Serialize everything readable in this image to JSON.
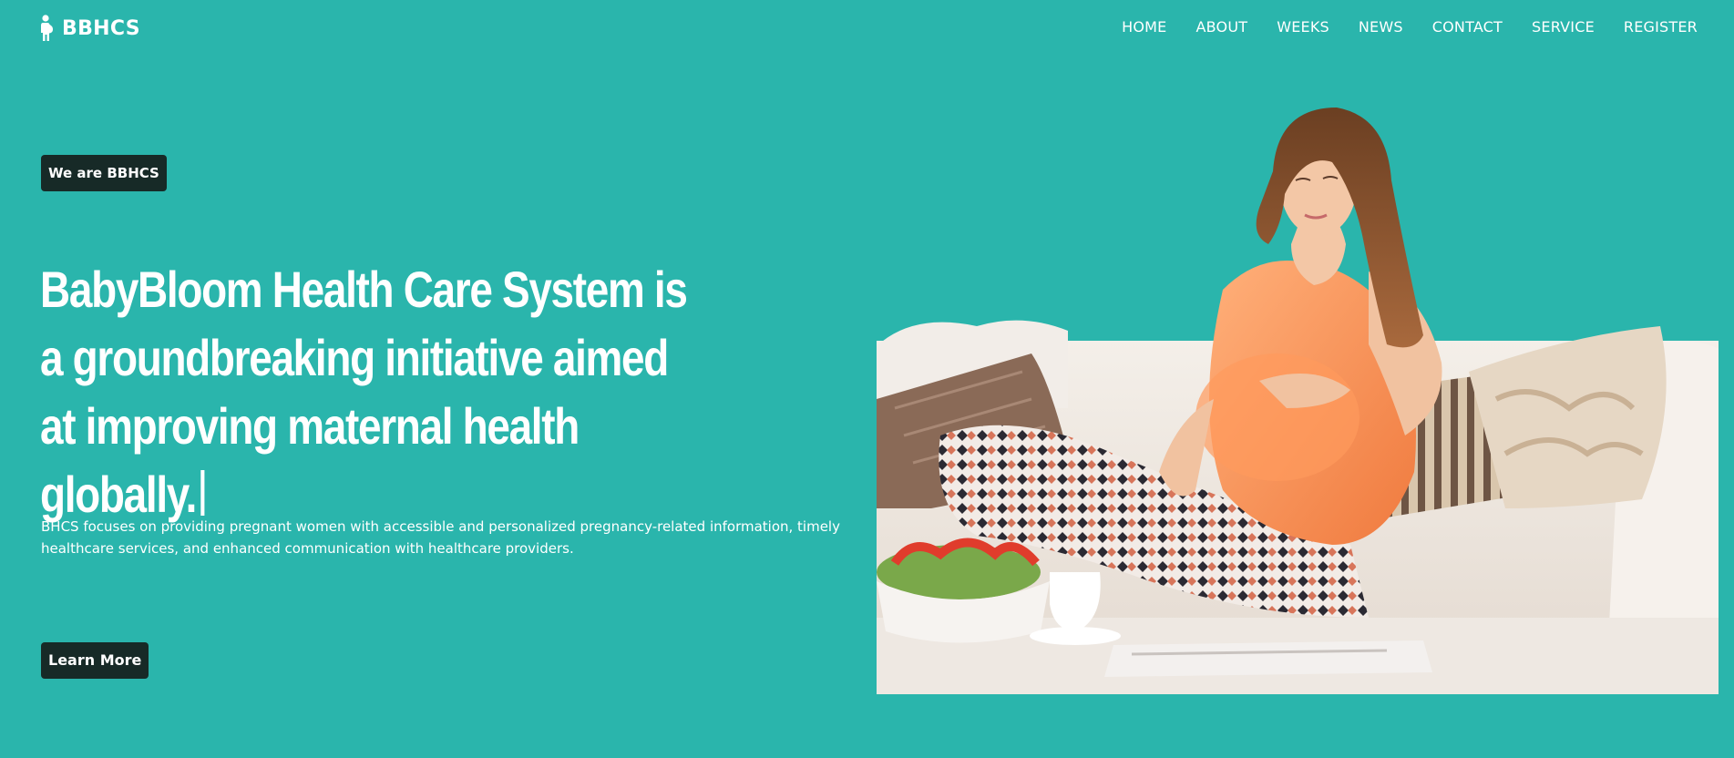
{
  "brand": {
    "name": "BBHCS",
    "icon": "pregnant-woman-icon"
  },
  "nav": {
    "items": [
      {
        "label": "HOME"
      },
      {
        "label": "ABOUT"
      },
      {
        "label": "WEEKS"
      },
      {
        "label": "NEWS"
      },
      {
        "label": "CONTACT"
      },
      {
        "label": "SERVICE"
      },
      {
        "label": "REGISTER"
      }
    ]
  },
  "hero": {
    "badge": "We are BBHCS",
    "headline": "BabyBloom Health Care System is a groundbreaking initiative aimed at improving maternal health globally.",
    "description": "BHCS focuses on providing pregnant women with accessible and personalized pregnancy-related information, timely healthcare services, and enhanced communication with healthcare providers.",
    "cta": "Learn More",
    "image": "pregnant-woman-on-sofa-photo"
  },
  "colors": {
    "background": "#2ab5ac",
    "dark_button": "#172a27",
    "text": "#ffffff"
  }
}
